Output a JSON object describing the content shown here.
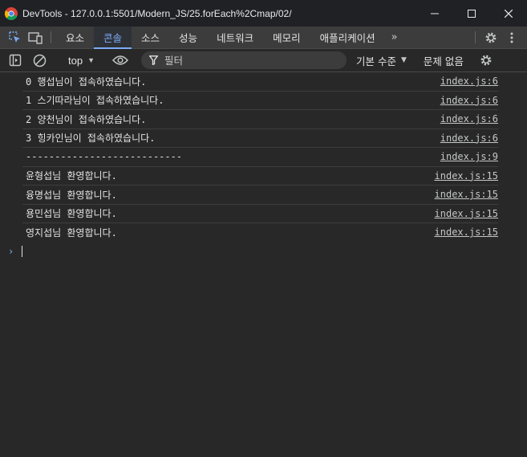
{
  "window": {
    "title": "DevTools - 127.0.0.1:5501/Modern_JS/25.forEach%2Cmap/02/",
    "buttons": [
      "minimize-icon",
      "maximize-icon",
      "close-icon"
    ]
  },
  "tabs": {
    "items": [
      {
        "label": "요소"
      },
      {
        "label": "콘솔",
        "active": true
      },
      {
        "label": "소스"
      },
      {
        "label": "성능"
      },
      {
        "label": "네트워크"
      },
      {
        "label": "메모리"
      },
      {
        "label": "애플리케이션"
      }
    ],
    "more": "»"
  },
  "toolbar": {
    "context": "top",
    "filter_placeholder": "필터",
    "levels": "기본 수준",
    "issues": "문제 없음"
  },
  "console": {
    "messages": [
      {
        "text": "0 행섭님이 접속하였습니다.",
        "source": "index.js:6"
      },
      {
        "text": "1 스기따라님이 접속하였습니다.",
        "source": "index.js:6"
      },
      {
        "text": "2 양천님이 접속하였습니다.",
        "source": "index.js:6"
      },
      {
        "text": "3 힝카인님이 접속하였습니다.",
        "source": "index.js:6"
      },
      {
        "text": "---------------------------",
        "source": "index.js:9"
      },
      {
        "text": "윤형섭님 환영합니다.",
        "source": "index.js:15"
      },
      {
        "text": "융명섭님 환영합니다.",
        "source": "index.js:15"
      },
      {
        "text": "용민섭님 환영합니다.",
        "source": "index.js:15"
      },
      {
        "text": "영지섭님 환영합니다.",
        "source": "index.js:15"
      }
    ],
    "prompt": "›"
  },
  "colors": {
    "accent": "#7cacf8",
    "panel_bg": "#282828",
    "titlebar_bg": "#202124"
  }
}
